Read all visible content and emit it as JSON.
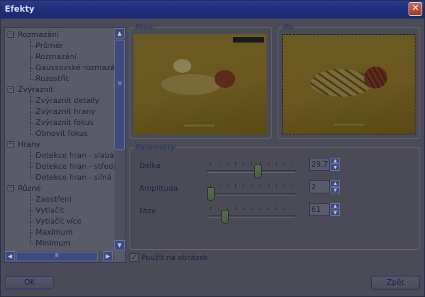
{
  "window": {
    "title": "Efekty",
    "close_glyph": "✕"
  },
  "tree": {
    "categories": [
      {
        "label": "Rozmazání",
        "expander": "−",
        "items": [
          "Průměr",
          "Rozmazání",
          "Gaussovské rozmazání",
          "Rozostřit"
        ]
      },
      {
        "label": "Zvýraznit",
        "expander": "−",
        "items": [
          "Zvýraznit detaily",
          "Zvýraznit hrany",
          "Zvýraznit fokus",
          "Obnovit fokus"
        ]
      },
      {
        "label": "Hrany",
        "expander": "−",
        "items": [
          "Detekce hran - slabá",
          "Detekce hran - střední",
          "Detekce hran - silná"
        ]
      },
      {
        "label": "Různé",
        "expander": "−",
        "items": [
          "Zaostření",
          "Vytlačit",
          "Vytlačit více",
          "Maximum",
          "Minimum"
        ]
      }
    ],
    "scroll_up": "▲",
    "scroll_down": "▼",
    "scroll_left": "◀",
    "scroll_right": "▶",
    "grip": "≡"
  },
  "preview": {
    "before_label": "Před",
    "after_label": "Po"
  },
  "params": {
    "group_label": "Parametry",
    "rows": [
      {
        "label": "Délka",
        "value": "29.7",
        "slider_fraction": 0.58
      },
      {
        "label": "Amplituda",
        "value": "2",
        "slider_fraction": 0.0
      },
      {
        "label": "Fáze",
        "value": "61",
        "slider_fraction": 0.18
      }
    ],
    "spin_up": "▲",
    "spin_down": "▼"
  },
  "apply_checkbox": {
    "label": "Použít na obrázek",
    "checked": true,
    "mark": "✓"
  },
  "buttons": {
    "ok": "OK",
    "back": "Zpět"
  },
  "colors": {
    "titlebar": "#1d2f7a",
    "close": "#9c3b29",
    "accent_label": "#2a3476",
    "dialog_bg": "#4a4b57"
  }
}
